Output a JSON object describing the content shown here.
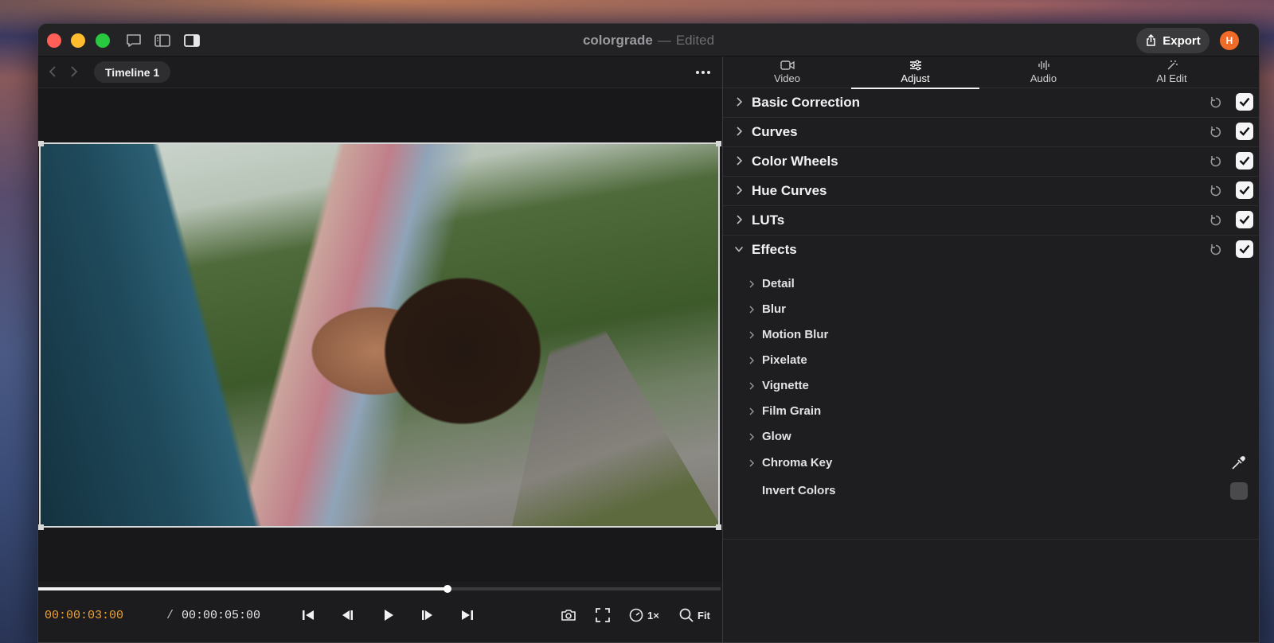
{
  "window": {
    "title": "colorgrade",
    "title_separator": "—",
    "state": "Edited",
    "export_label": "Export",
    "avatar_initial": "H"
  },
  "viewer": {
    "timeline_tab": "Timeline 1",
    "current_time": "00:00:03:00",
    "time_separator": "/",
    "total_time": "00:00:05:00",
    "progress": 0.6,
    "speed_label": "1×",
    "zoom_label": "Fit"
  },
  "inspector": {
    "tabs": [
      {
        "label": "Video",
        "icon": "video-camera-icon"
      },
      {
        "label": "Adjust",
        "icon": "sliders-icon",
        "active": true
      },
      {
        "label": "Audio",
        "icon": "waveform-icon"
      },
      {
        "label": "AI Edit",
        "icon": "magic-wand-icon"
      }
    ],
    "sections": [
      {
        "label": "Basic Correction",
        "expanded": false,
        "enabled": true
      },
      {
        "label": "Curves",
        "expanded": false,
        "enabled": true
      },
      {
        "label": "Color Wheels",
        "expanded": false,
        "enabled": true
      },
      {
        "label": "Hue Curves",
        "expanded": false,
        "enabled": true
      },
      {
        "label": "LUTs",
        "expanded": false,
        "enabled": true
      },
      {
        "label": "Effects",
        "expanded": true,
        "enabled": true
      }
    ],
    "effects": [
      {
        "label": "Detail"
      },
      {
        "label": "Blur"
      },
      {
        "label": "Motion Blur"
      },
      {
        "label": "Pixelate"
      },
      {
        "label": "Vignette"
      },
      {
        "label": "Film Grain"
      },
      {
        "label": "Glow"
      },
      {
        "label": "Chroma Key"
      },
      {
        "label": "Invert Colors",
        "enabled": false
      }
    ]
  },
  "colors": {
    "accent_time": "#f0a236",
    "traffic_close": "#ff5f57",
    "traffic_min": "#febc2e",
    "traffic_max": "#28c840",
    "avatar": "#f06a28"
  }
}
